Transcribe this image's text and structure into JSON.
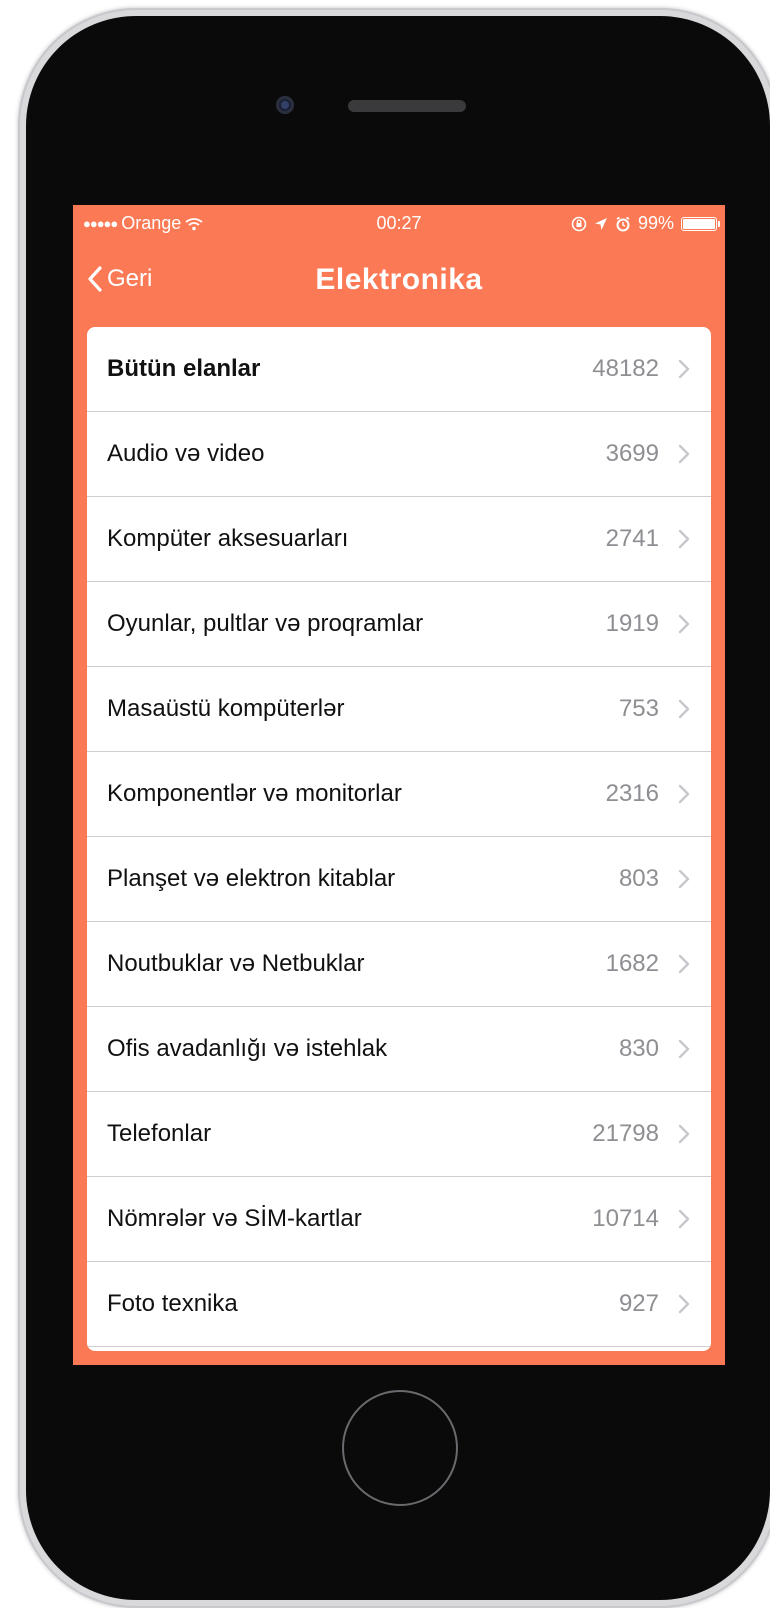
{
  "status_bar": {
    "signal_dots": "●●●●●",
    "carrier": "Orange",
    "wifi_icon": "wifi-icon",
    "time": "00:27",
    "battery_percent": "99%",
    "battery_level": 0.99
  },
  "nav": {
    "back_label": "Geri",
    "title": "Elektronika"
  },
  "categories": [
    {
      "label": "Bütün elanlar",
      "count": "48182"
    },
    {
      "label": "Audio və video",
      "count": "3699"
    },
    {
      "label": "Kompüter aksesuarları",
      "count": "2741"
    },
    {
      "label": "Oyunlar, pultlar və proqramlar",
      "count": "1919"
    },
    {
      "label": "Masaüstü kompüterlər",
      "count": "753"
    },
    {
      "label": "Komponentlər və monitorlar",
      "count": "2316"
    },
    {
      "label": "Planşet və elektron kitablar",
      "count": "803"
    },
    {
      "label": "Noutbuklar və Netbuklar",
      "count": "1682"
    },
    {
      "label": "Ofis avadanlığı və istehlak",
      "count": "830"
    },
    {
      "label": "Telefonlar",
      "count": "21798"
    },
    {
      "label": "Nömrələr və SİM-kartlar",
      "count": "10714"
    },
    {
      "label": "Foto texnika",
      "count": "927"
    }
  ],
  "colors": {
    "accent": "#fb7954",
    "count_text": "#8e8e93",
    "separator": "#cfcfd3"
  }
}
